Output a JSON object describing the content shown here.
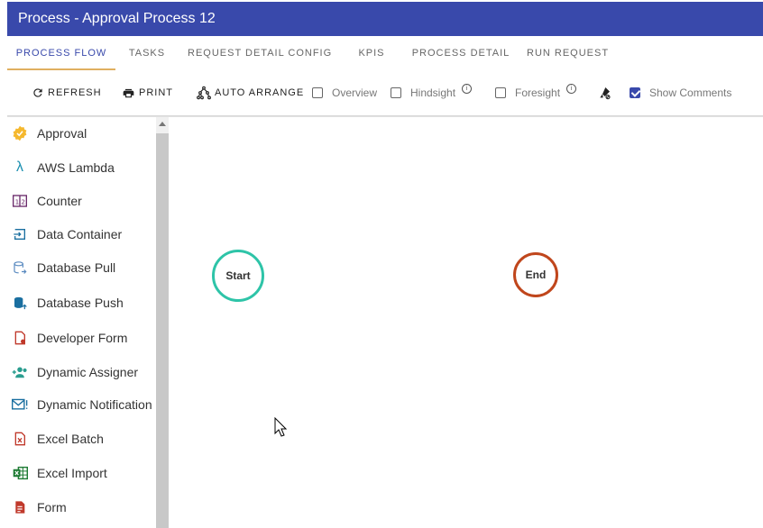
{
  "window": {
    "title": "Process - Approval Process 12"
  },
  "tabs": [
    {
      "label": "PROCESS FLOW",
      "active": true
    },
    {
      "label": "TASKS"
    },
    {
      "label": "REQUEST DETAIL CONFIG"
    },
    {
      "label": "KPIS"
    },
    {
      "label": "PROCESS DETAIL"
    },
    {
      "label": "RUN REQUEST"
    }
  ],
  "toolbar": {
    "refresh_label": "REFRESH",
    "print_label": "PRINT",
    "auto_arrange_label": "AUTO ARRANGE",
    "overview_label": "Overview",
    "overview_checked": false,
    "hindsight_label": "Hindsight",
    "hindsight_checked": false,
    "foresight_label": "Foresight",
    "foresight_checked": false,
    "show_comments_label": "Show Comments",
    "show_comments_checked": true
  },
  "sidebar": {
    "items": [
      {
        "label": "Approval",
        "icon": "approval-badge-icon"
      },
      {
        "label": "AWS Lambda",
        "icon": "lambda-icon"
      },
      {
        "label": "Counter",
        "icon": "counter-icon"
      },
      {
        "label": "Data Container",
        "icon": "data-container-icon"
      },
      {
        "label": "Database Pull",
        "icon": "database-pull-icon"
      },
      {
        "label": "Database Push",
        "icon": "database-push-icon"
      },
      {
        "label": "Developer Form",
        "icon": "developer-form-icon"
      },
      {
        "label": "Dynamic Assigner",
        "icon": "dynamic-assigner-icon"
      },
      {
        "label": "Dynamic Notification",
        "icon": "dynamic-notification-icon"
      },
      {
        "label": "Excel Batch",
        "icon": "excel-batch-icon"
      },
      {
        "label": "Excel Import",
        "icon": "excel-import-icon"
      },
      {
        "label": "Form",
        "icon": "form-icon"
      }
    ]
  },
  "canvas": {
    "start_label": "Start",
    "end_label": "End"
  },
  "colors": {
    "header": "#3949ab",
    "start_node": "#2ec4a8",
    "end_node": "#c0461c"
  }
}
